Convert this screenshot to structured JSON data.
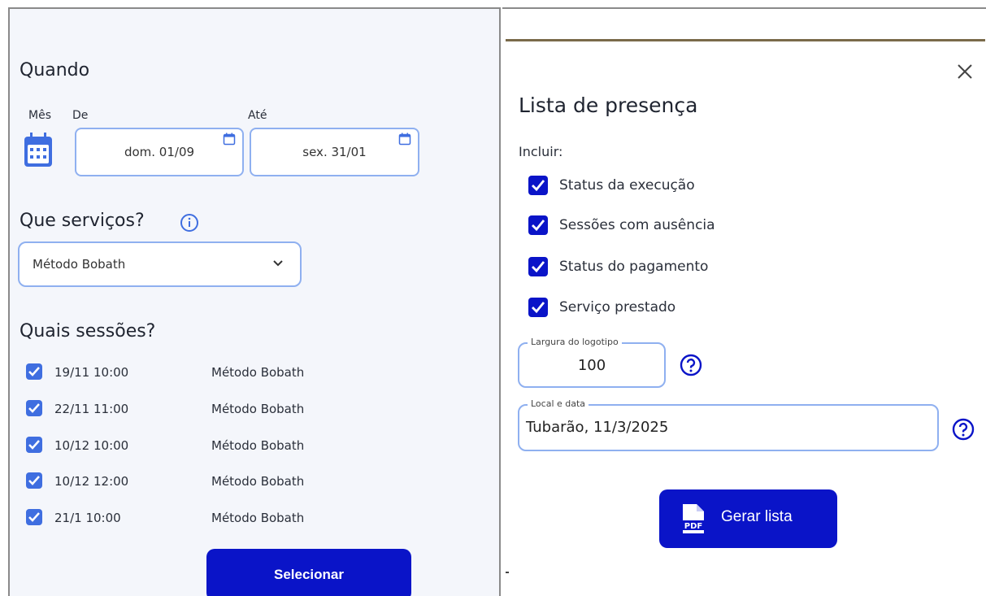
{
  "left": {
    "when_title": "Quando",
    "month_label": "Mês",
    "from_label": "De",
    "to_label": "Até",
    "from_value": "dom. 01/09",
    "to_value": "sex. 31/01",
    "services_title": "Que serviços?",
    "service_selected": "Método Bobath",
    "sessions_title": "Quais sessões?",
    "sessions": [
      {
        "date": "19/11 10:00",
        "service": "Método Bobath",
        "checked": true
      },
      {
        "date": "22/11 11:00",
        "service": "Método Bobath",
        "checked": true
      },
      {
        "date": "10/12 10:00",
        "service": "Método Bobath",
        "checked": true
      },
      {
        "date": "10/12 12:00",
        "service": "Método Bobath",
        "checked": true
      },
      {
        "date": "21/1 10:00",
        "service": "Método Bobath",
        "checked": true
      }
    ],
    "select_button": "Selecionar"
  },
  "dialog": {
    "title": "Lista de presença",
    "include_label": "Incluir:",
    "options": [
      {
        "label": "Status da execução",
        "checked": true
      },
      {
        "label": "Sessões com ausência",
        "checked": true
      },
      {
        "label": "Status do pagamento",
        "checked": true
      },
      {
        "label": "Serviço prestado",
        "checked": true
      }
    ],
    "logo_width_label": "Largura do logotipo",
    "logo_width_value": "100",
    "place_date_label": "Local e data",
    "place_date_value": "Tubarão, 11/3/2025",
    "generate_button": "Gerar lista",
    "pdf_icon_text": "PDF"
  },
  "colors": {
    "primary": "#0a14c8",
    "checkbox_light": "#3f6ee0",
    "field_border": "#8fb0f0",
    "panel_bg": "#f4f6fb"
  },
  "icons": [
    "calendar-icon",
    "info-icon",
    "chevron-down-icon",
    "checkbox-checked-icon",
    "close-icon",
    "help-icon",
    "pdf-icon"
  ]
}
